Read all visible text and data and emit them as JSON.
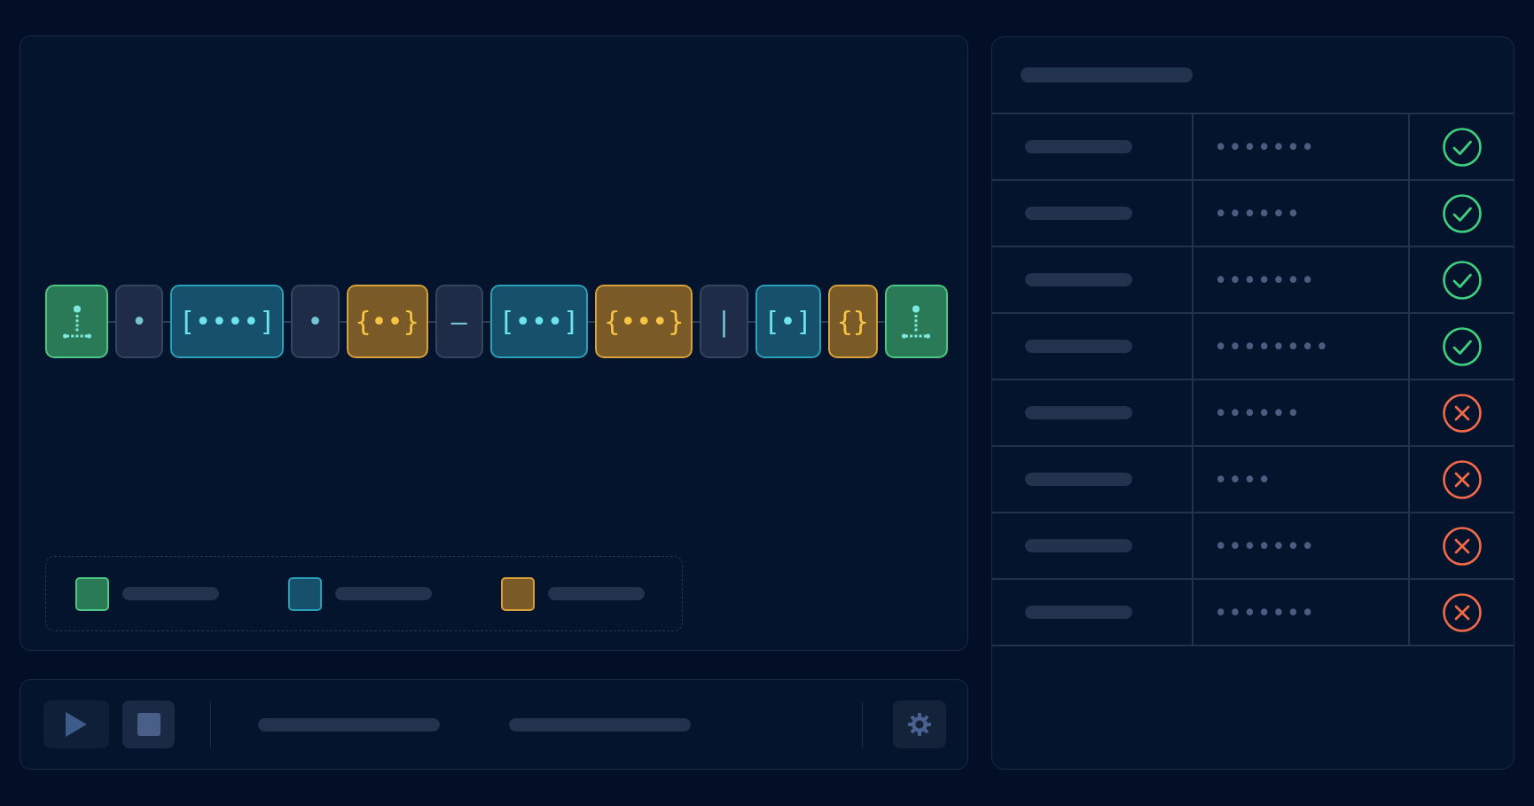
{
  "sequence": {
    "tokens": [
      {
        "kind": "terminal"
      },
      {
        "kind": "atom",
        "text": "•"
      },
      {
        "kind": "array",
        "text": "[••••]"
      },
      {
        "kind": "atom",
        "text": "•"
      },
      {
        "kind": "object",
        "text": "{••}"
      },
      {
        "kind": "atom",
        "text": "—"
      },
      {
        "kind": "array",
        "text": "[•••]"
      },
      {
        "kind": "object",
        "text": "{•••}"
      },
      {
        "kind": "atom",
        "text": "|"
      },
      {
        "kind": "array",
        "text": "[•]"
      },
      {
        "kind": "object",
        "text": "{}"
      },
      {
        "kind": "terminal"
      }
    ]
  },
  "legend": [
    {
      "kind": "terminal"
    },
    {
      "kind": "array"
    },
    {
      "kind": "object"
    }
  ],
  "toolbar": {
    "buttons": [
      {
        "kind": "play"
      },
      {
        "kind": "stop"
      }
    ],
    "end_buttons": [
      {
        "kind": "settings"
      }
    ]
  },
  "results": {
    "rows": [
      {
        "value": "•••••••",
        "passed": true
      },
      {
        "value": "••••••",
        "passed": true
      },
      {
        "value": "•••••••",
        "passed": true
      },
      {
        "value": "••••••••",
        "passed": true
      },
      {
        "value": "••••••",
        "passed": false
      },
      {
        "value": "••••",
        "passed": false
      },
      {
        "value": "•••••••",
        "passed": false
      },
      {
        "value": "•••••••",
        "passed": false
      }
    ]
  }
}
